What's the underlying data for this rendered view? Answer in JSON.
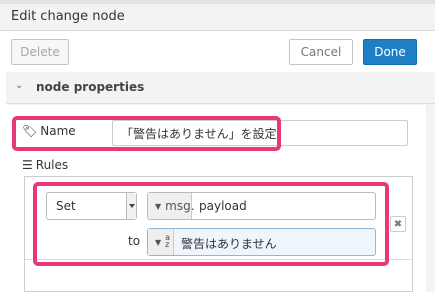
{
  "header": {
    "title": "Edit change node"
  },
  "toolbar": {
    "delete_label": "Delete",
    "cancel_label": "Cancel",
    "done_label": "Done"
  },
  "section": {
    "label": "node properties",
    "chevron_icon": "chevron-down-icon"
  },
  "name_field": {
    "label": "Name",
    "icon": "tag-icon",
    "value": "「警告はありません」を設定"
  },
  "rules": {
    "label": "Rules",
    "icon": "list-icon",
    "items": [
      {
        "action": "Set",
        "property_type": "msg.",
        "property": "payload",
        "to_label": "to",
        "value_type_icon": "string-type-icon",
        "value_type_glyph": "a\nz",
        "value": "警告はありません"
      }
    ]
  },
  "colors": {
    "highlight": "#e8377a",
    "done_button": "#1e7fc5"
  }
}
